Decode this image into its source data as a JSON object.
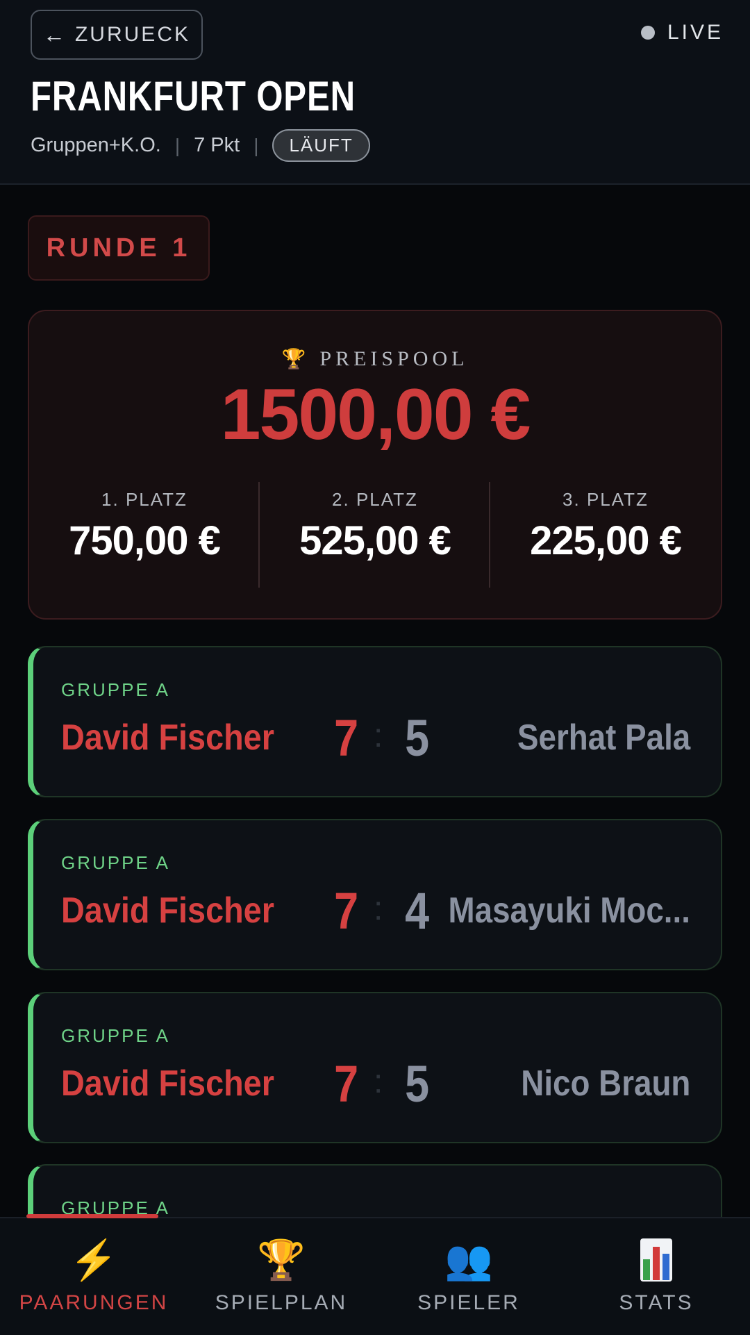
{
  "header": {
    "back_label": "ZURUECK",
    "live_label": "LIVE",
    "title": "FRANKFURT OPEN",
    "mode": "Gruppen+K.O.",
    "points": "7 Pkt",
    "status": "LÄUFT"
  },
  "round": {
    "label": "RUNDE 1"
  },
  "prize_pool": {
    "label": "PREISPOOL",
    "total": "1500,00 €",
    "places": [
      {
        "label": "1. PLATZ",
        "amount": "750,00 €"
      },
      {
        "label": "2. PLATZ",
        "amount": "525,00 €"
      },
      {
        "label": "3. PLATZ",
        "amount": "225,00 €"
      }
    ]
  },
  "matches": [
    {
      "group": "GRUPPE A",
      "player_left": "David Fischer",
      "score_left": "7",
      "score_right": "5",
      "player_right": "Serhat Pala"
    },
    {
      "group": "GRUPPE A",
      "player_left": "David Fischer",
      "score_left": "7",
      "score_right": "4",
      "player_right": "Masayuki Moc..."
    },
    {
      "group": "GRUPPE A",
      "player_left": "David Fischer",
      "score_left": "7",
      "score_right": "5",
      "player_right": "Nico Braun"
    },
    {
      "group": "GRUPPE A"
    }
  ],
  "nav": {
    "items": [
      {
        "label": "PAARUNGEN",
        "icon": "lightning-icon",
        "active": true
      },
      {
        "label": "SPIELPLAN",
        "icon": "trophy-icon",
        "active": false
      },
      {
        "label": "SPIELER",
        "icon": "people-icon",
        "active": false
      },
      {
        "label": "STATS",
        "icon": "bar-chart-icon",
        "active": false
      }
    ]
  },
  "colors": {
    "accent_red": "#d64141",
    "win_green": "#5cd07a",
    "background": "#06080b"
  }
}
